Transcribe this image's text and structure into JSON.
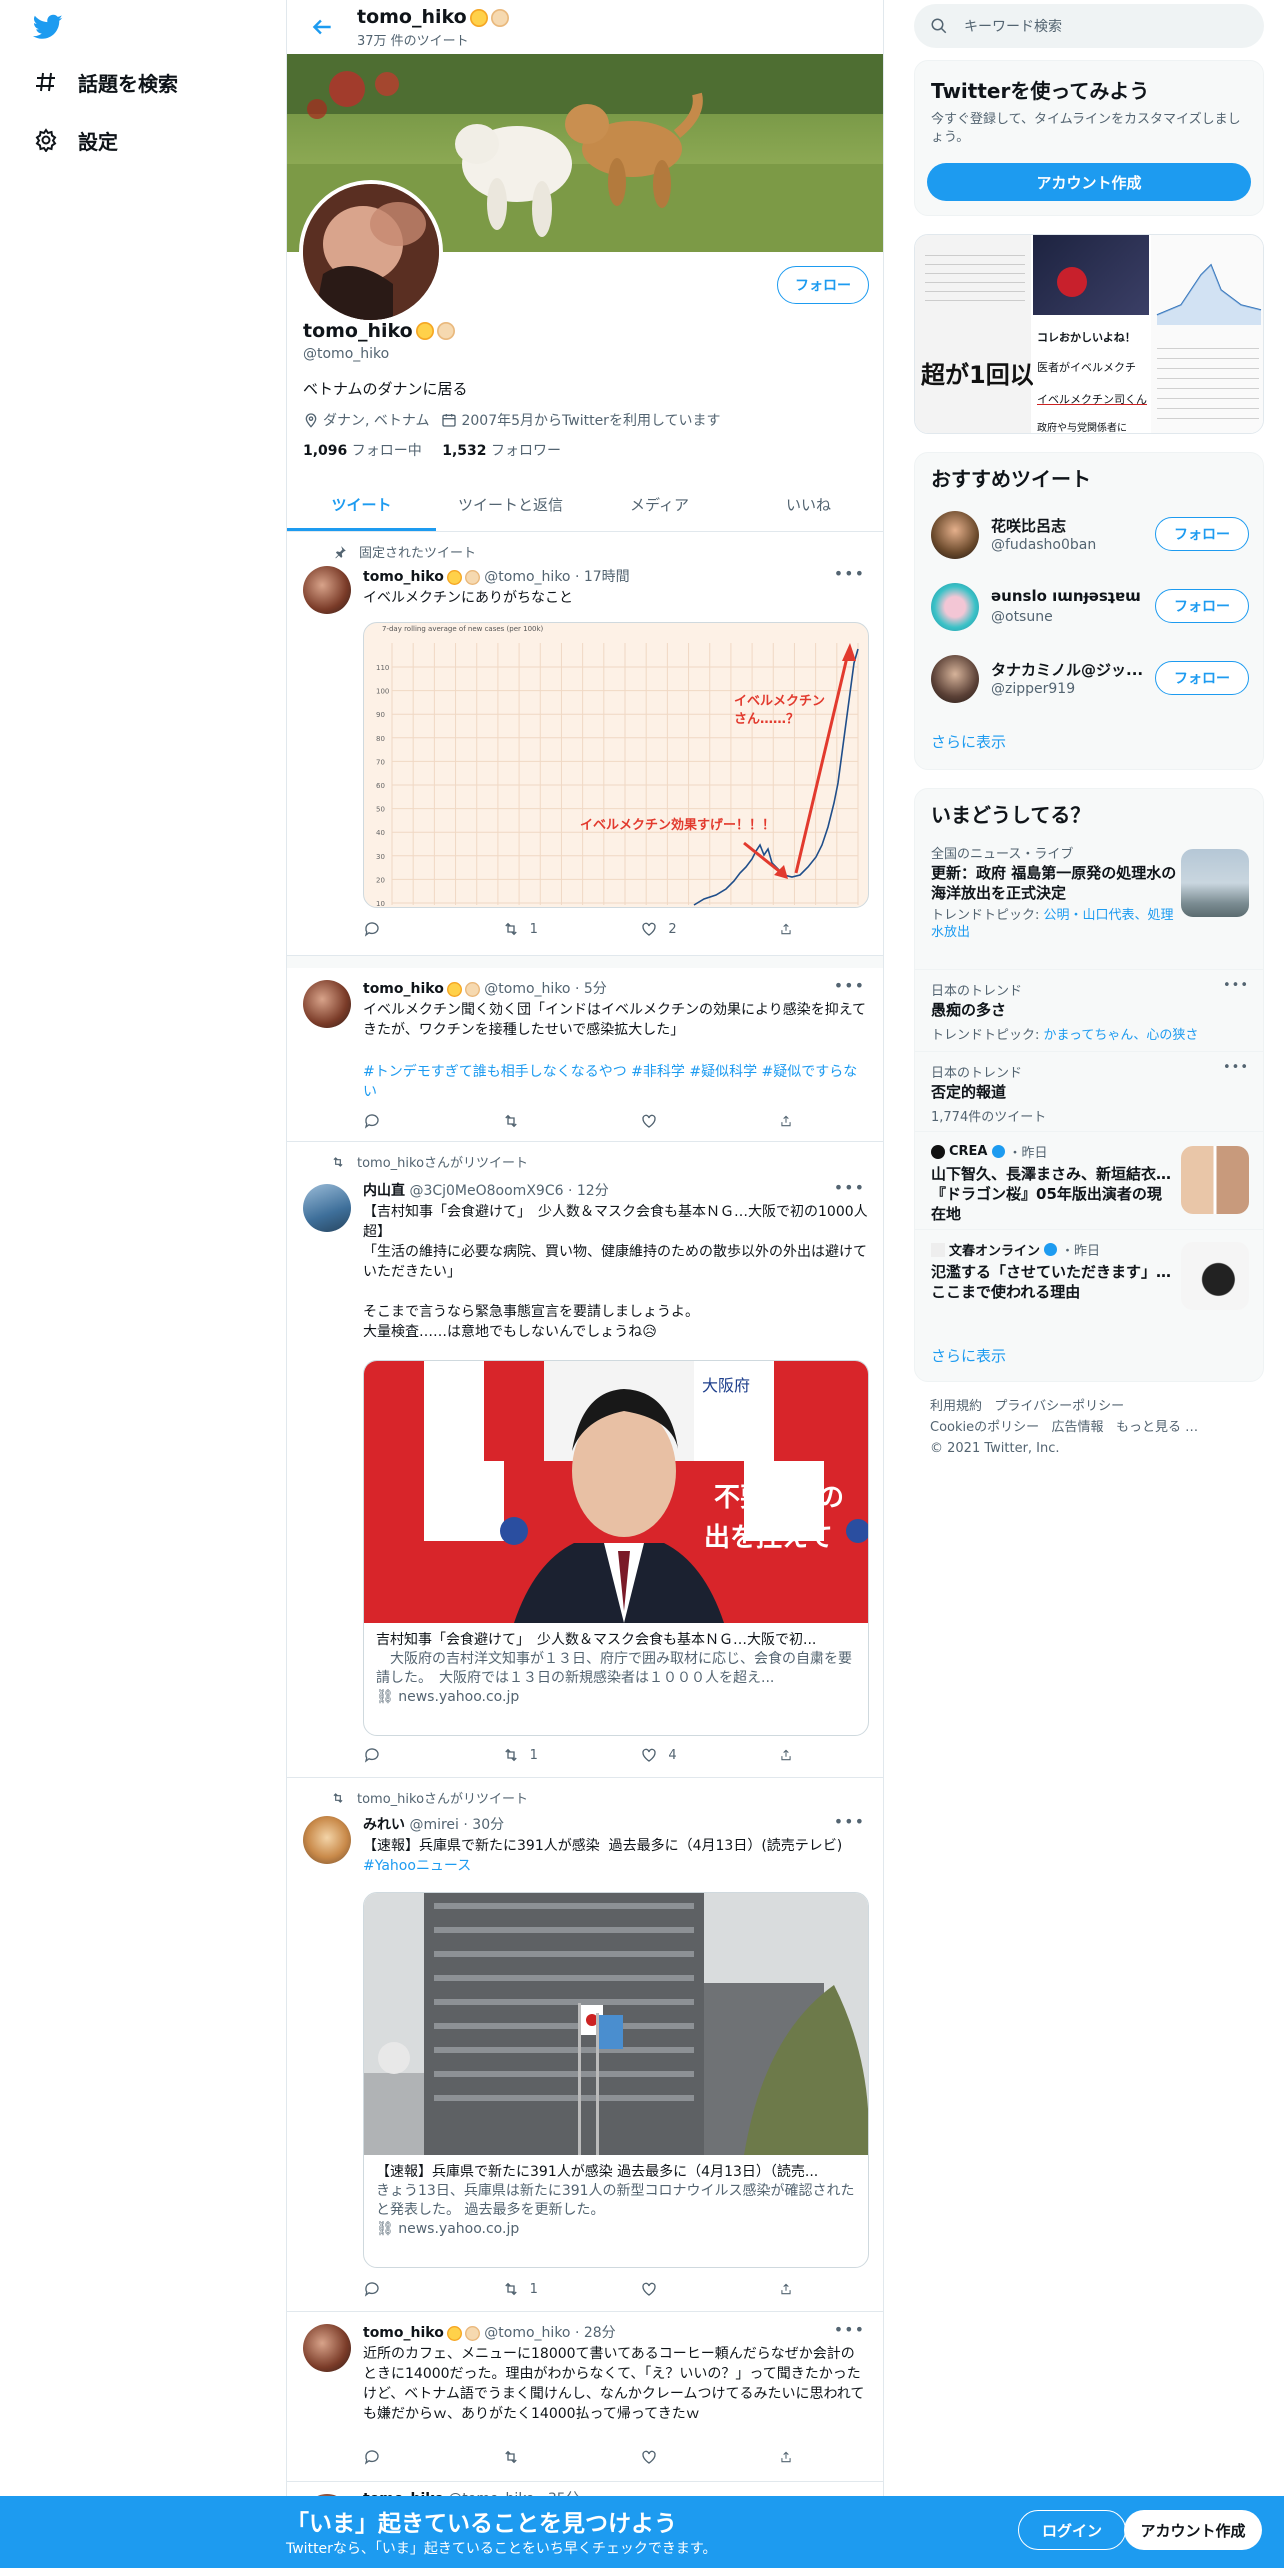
{
  "nav": {
    "explore": "話題を検索",
    "settings": "設定"
  },
  "header": {
    "name": "tomo_hiko",
    "tweet_count": "37万 件のツイート"
  },
  "profile": {
    "name": "tomo_hiko",
    "handle": "@tomo_hiko",
    "bio": "ベトナムのダナンに居る",
    "location": "ダナン, ベトナム",
    "joined": "2007年5月からTwitterを利用しています",
    "following_count": "1,096",
    "following_label": "フォロー中",
    "followers_count": "1,532",
    "followers_label": "フォロワー",
    "follow_button": "フォロー"
  },
  "tabs": [
    "ツイート",
    "ツイートと返信",
    "メディア",
    "いいね"
  ],
  "tweets": [
    {
      "context": "固定されたツイート",
      "name": "tomo_hiko",
      "handle": "@tomo_hiko",
      "time": "17時間",
      "text": "イベルメクチンにありがちなこと",
      "retweets": "1",
      "likes": "2",
      "chart": {
        "title": "7-day rolling average of new cases (per 100k)",
        "annot1": "イベルメクチン\nさん……？",
        "annot2": "イベルメクチン効果すげー！！！",
        "yticks": [
          "110",
          "100",
          "90",
          "80",
          "70",
          "60",
          "50",
          "40",
          "30",
          "20",
          "10"
        ]
      }
    },
    {
      "name": "tomo_hiko",
      "handle": "@tomo_hiko",
      "time": "5分",
      "text": "イベルメクチン聞く効く団「インドはイベルメクチンの効果により感染を抑えてきたが、ワクチンを接種したせいで感染拡大した」",
      "hashtags": "#トンデモすぎて誰も相手しなくなるやつ #非科学 #疑似科学 #疑似ですらない"
    },
    {
      "context": "tomo_hikoさんがリツイート",
      "name": "内山直",
      "handle": "@3Cj0MeO8oomX9C6",
      "time": "12分",
      "text": "【吉村知事「会食避けて」　少人数＆マスク会食も基本ＮＧ…大阪で初の1000人超】\n「生活の維持に必要な病院、買い物、健康維持のための散歩以外の外出は避けていただきたい」\n\nそこまで言うなら緊急事態宣言を要請しましょうよ。\n大量検査……は意地でもしないんでしょうね😥",
      "retweets": "1",
      "likes": "4",
      "card": {
        "title": "吉村知事「会食避けて」　少人数＆マスク会食も基本ＮＧ…大阪で初...",
        "desc": "　大阪府の吉村洋文知事が１３日、府庁で囲み取材に応じ、会食の自粛を要請した。　大阪府では１３日の新規感染者は１０００人を超え...",
        "domain": "news.yahoo.co.jp",
        "sign1": "大阪府",
        "sign2": "不要不急の",
        "sign3": "出を控えて"
      }
    },
    {
      "context": "tomo_hikoさんがリツイート",
      "name": "みれい",
      "handle": "@mirei",
      "time": "30分",
      "text": "【速報】兵庫県で新たに391人が感染  過去最多に（4月13日）(読売テレビ)",
      "hashtag": "#Yahooニュース",
      "retweets": "1",
      "card": {
        "title": "【速報】兵庫県で新たに391人が感染  過去最多に（4月13日）（読売...",
        "desc": "きょう13日、兵庫県は新たに391人の新型コロナウイルス感染が確認されたと発表した。 過去最多を更新した。",
        "domain": "news.yahoo.co.jp"
      }
    },
    {
      "name": "tomo_hiko",
      "handle": "@tomo_hiko",
      "time": "28分",
      "text": "近所のカフェ、メニューに18000て書いてあるコーヒー頼んだらなぜか会計のときに14000だった。理由がわからなくて、「え？いいの？」って聞きたかったけど、ベトナム語でうまく聞けんし、なんかクレームつけてるみたいに思われても嫌だからｗ、ありがたく14000払って帰ってきたｗ"
    },
    {
      "name": "tomo_hiko",
      "handle": "@tomo_hiko",
      "time": "35分"
    }
  ],
  "sidebar": {
    "search_placeholder": "キーワード検索",
    "signup_title": "Twitterを使ってみよう",
    "signup_desc": "今すぐ登録して、タイムラインをカスタマイズしましょう。",
    "signup_button": "アカウント作成",
    "media_text1": "超が1回以",
    "media_text2": "コレおかしいよね！",
    "media_text3": "医者がイベルメクチ",
    "media_text4": "イベルメクチン司くん",
    "media_text5": "政府や与党関係者に",
    "recommend_title": "おすすめツイート",
    "recommend": [
      {
        "name": "花咲比呂志",
        "handle": "@fudasho0ban",
        "button": "フォロー"
      },
      {
        "name": "əunslo ıɯnɟəsʇɐɯ",
        "handle": "@otsune",
        "button": "フォロー"
      },
      {
        "name": "タナカミノル@ジッ...",
        "handle": "@zipper919",
        "button": "フォロー"
      }
    ],
    "show_more": "さらに表示",
    "trends_title": "いまどうしてる？",
    "trends": [
      {
        "meta": "全国のニュース・ライブ",
        "title": "更新：政府 福島第一原発の処理水の海洋放出を正式決定",
        "sub_label": "トレンドトピック: ",
        "sub_links": "公明・山口代表、処理水放出"
      },
      {
        "meta": "日本のトレンド",
        "title": "愚痴の多さ",
        "sub_label": "トレンドトピック: ",
        "sub_links": "かまってちゃん、心の狭さ"
      },
      {
        "meta": "日本のトレンド",
        "title": "否定的報道",
        "sub": "1,774件のツイート"
      },
      {
        "source": "CREA",
        "time": "・昨日",
        "title": "山下智久、長澤まさみ、新垣結衣…『ドラゴン桜』05年版出演者の現在地"
      },
      {
        "source": "文春オンライン",
        "time": "・昨日",
        "title": "氾濫する「させていただきます」…ここまで使われる理由"
      }
    ],
    "show_more2": "さらに表示",
    "footer": [
      "利用規約",
      "プライバシーポリシー",
      "Cookieのポリシー",
      "広告情報",
      "もっと見る …",
      "© 2021 Twitter, Inc."
    ]
  },
  "bottom": {
    "title": "「いま」起きていることを見つけよう",
    "sub": "Twitterなら、「いま」起きていることをいち早くチェックできます。",
    "login": "ログイン",
    "signup": "アカウント作成"
  },
  "colors": {
    "accent": "#1d9bf0",
    "text": "#0f1419",
    "muted": "#536471"
  }
}
